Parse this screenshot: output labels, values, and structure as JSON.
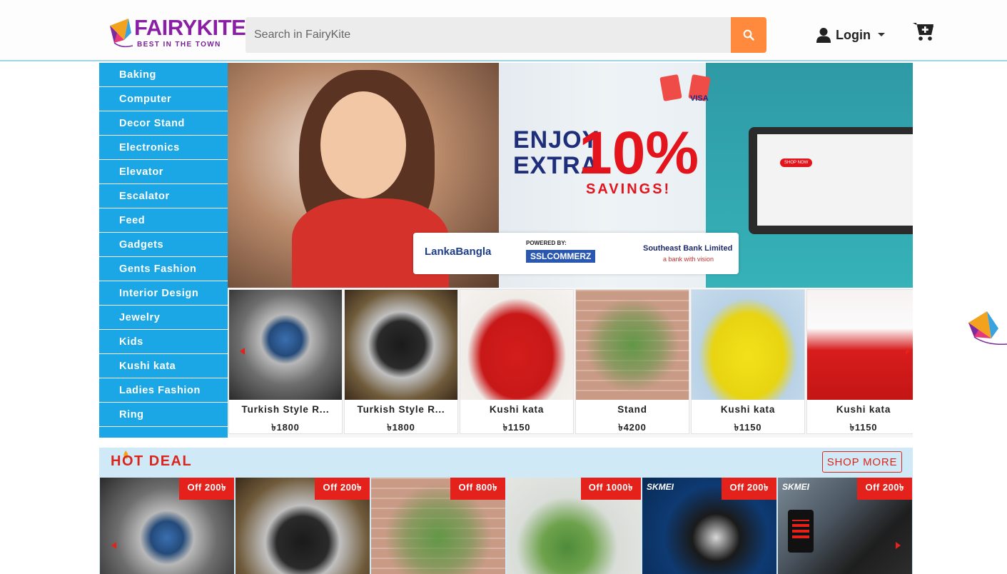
{
  "header": {
    "logo_text": "FAIRYKITE",
    "logo_tagline": "BEST IN THE TOWN",
    "search_placeholder": "Search in FairyKite",
    "login_label": "Login"
  },
  "sidebar": {
    "items": [
      {
        "label": "Baking"
      },
      {
        "label": "Computer"
      },
      {
        "label": "Decor Stand"
      },
      {
        "label": "Electronics"
      },
      {
        "label": "Elevator"
      },
      {
        "label": "Escalator"
      },
      {
        "label": "Feed"
      },
      {
        "label": "Gadgets"
      },
      {
        "label": "Gents Fashion"
      },
      {
        "label": "Interior Design"
      },
      {
        "label": "Jewelry"
      },
      {
        "label": "Kids"
      },
      {
        "label": "Kushi kata"
      },
      {
        "label": "Ladies Fashion"
      },
      {
        "label": "Ring"
      }
    ]
  },
  "banner": {
    "line1": "ENJOY",
    "line2": "EXTRA",
    "percent": "10%",
    "savings": "SAVINGS!",
    "partner1": "LankaBangla",
    "partner2_powered": "POWERED BY:",
    "partner2": "SSLCOMMERZ",
    "partner3": "Southeast Bank Limited",
    "partner3_tag": "a bank with vision",
    "card_label": "VISA",
    "screen_button": "SHOP NOW"
  },
  "products": [
    {
      "name": "Turkish Style R...",
      "price": "৳1800",
      "theme": "ring-blue"
    },
    {
      "name": "Turkish Style R...",
      "price": "৳1800",
      "theme": "ring-black"
    },
    {
      "name": "Kushi kata",
      "price": "৳1150",
      "theme": "dress-red"
    },
    {
      "name": "Stand",
      "price": "৳4200",
      "theme": "stand"
    },
    {
      "name": "Kushi kata",
      "price": "৳1150",
      "theme": "dress-yellow"
    },
    {
      "name": "Kushi kata",
      "price": "৳1150",
      "theme": "dress-red-white"
    }
  ],
  "hot_deal": {
    "title": "HOT DEAL",
    "shop_more": "SHOP MORE",
    "deals": [
      {
        "badge": "Off 200৳",
        "theme": "ring-blue"
      },
      {
        "badge": "Off 200৳",
        "theme": "ring-black"
      },
      {
        "badge": "Off 800৳",
        "theme": "stand"
      },
      {
        "badge": "Off 1000৳",
        "theme": "plant"
      },
      {
        "badge": "Off 200৳",
        "theme": "watch-blue",
        "brand": "SKMEI"
      },
      {
        "badge": "Off 200৳",
        "theme": "watch-led",
        "brand": "SKMEI"
      }
    ]
  },
  "colors": {
    "sidebar": "#1ba7e6",
    "search_button": "#ff8a3d",
    "hot_deal_bg": "#cfeaf6",
    "badge": "#e4221b",
    "logo": "#8a1fa6"
  }
}
